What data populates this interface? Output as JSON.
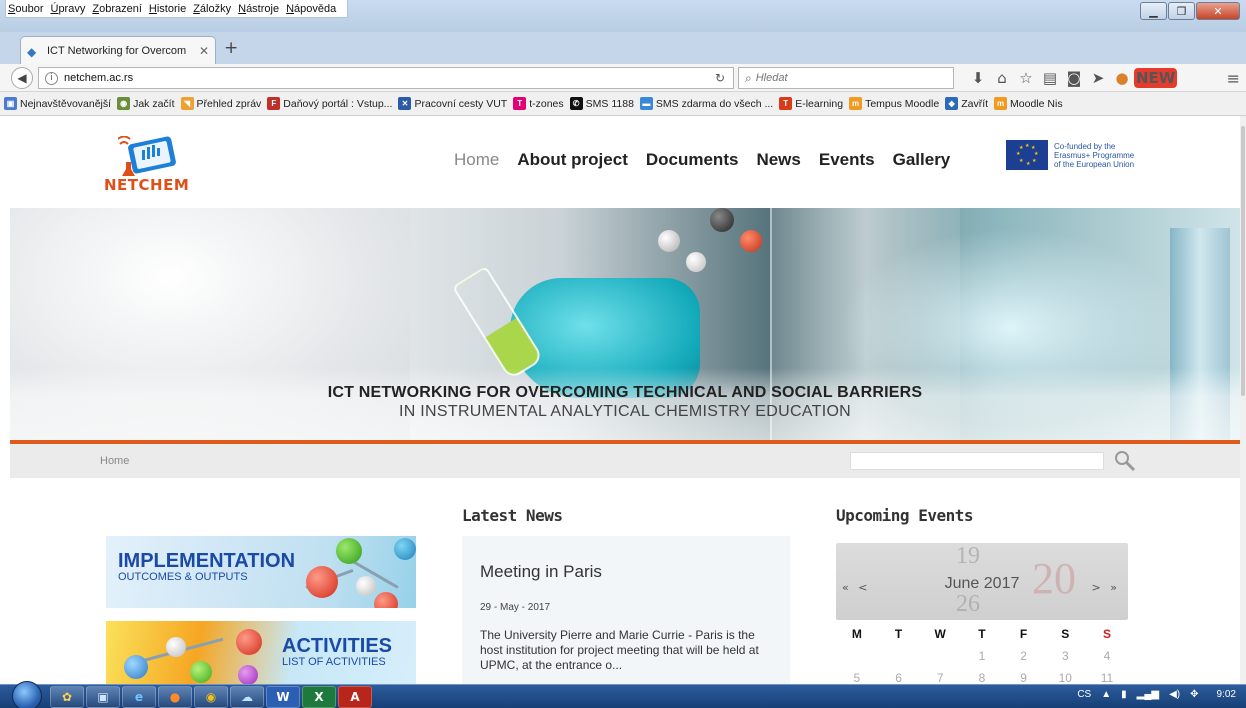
{
  "browser": {
    "menu": [
      "Soubor",
      "Úpravy",
      "Zobrazení",
      "Historie",
      "Záložky",
      "Nástroje",
      "Nápověda"
    ],
    "tab_title": "ICT Networking for Overcom",
    "url": "netchem.ac.rs",
    "search_placeholder": "Hledat",
    "new_badge": "NEW",
    "bookmarks": [
      {
        "label": "Nejnavštěvovanější",
        "color": "#4a7bd0"
      },
      {
        "label": "Jak začít",
        "color": "#6b8e3a"
      },
      {
        "label": "Přehled zpráv",
        "color": "#f0a030"
      },
      {
        "label": "Daňový portál : Vstup...",
        "color": "#c0302a"
      },
      {
        "label": "Pracovní cesty VUT",
        "color": "#2a5aa8"
      },
      {
        "label": "t-zones",
        "color": "#e20074"
      },
      {
        "label": "SMS 1188",
        "color": "#111111"
      },
      {
        "label": "SMS zdarma do všech ...",
        "color": "#3a88d8"
      },
      {
        "label": "E-learning",
        "color": "#d83a1a"
      },
      {
        "label": "Tempus Moodle",
        "color": "#f09a20"
      },
      {
        "label": "Zavřít",
        "color": "#2a6ab8"
      },
      {
        "label": "Moodle Nis",
        "color": "#f09a20"
      }
    ]
  },
  "site": {
    "logo_text": "NETCHEM",
    "nav": [
      "Home",
      "About project",
      "Documents",
      "News",
      "Events",
      "Gallery"
    ],
    "active_nav": "Home",
    "eu_text": [
      "Co-funded by the",
      "Erasmus+ Programme",
      "of the European Union"
    ],
    "hero_line1": "ICT NETWORKING FOR OVERCOMING TECHNICAL  AND SOCIAL BARRIERS",
    "hero_line2": "IN INSTRUMENTAL ANALYTICAL CHEMISTRY EDUCATION",
    "breadcrumb": "Home",
    "banner1_title": "IMPLEMENTATION",
    "banner1_sub": "OUTCOMES & OUTPUTS",
    "banner2_title": "ACTIVITIES",
    "banner2_sub": "LIST OF ACTIVITIES",
    "news_heading": "Latest News",
    "news_title": "Meeting in Paris",
    "news_date": "29 - May - 2017",
    "news_body": "The University Pierre and Marie Currie - Paris is the host institution for project meeting that will be held at UPMC, at the entrance o...",
    "events_heading": "Upcoming Events",
    "calendar": {
      "month": "June 2017",
      "prev": "« <",
      "next": "> »",
      "ghost_numbers": [
        "19",
        "20",
        "26"
      ],
      "weekdays": [
        "M",
        "T",
        "W",
        "T",
        "F",
        "S",
        "S"
      ],
      "row1": [
        "",
        "",
        "",
        "1",
        "2",
        "3",
        "4"
      ],
      "row2": [
        "5",
        "6",
        "7",
        "8",
        "9",
        "10",
        "11"
      ]
    }
  },
  "taskbar": {
    "lang": "CS",
    "clock": "9:02"
  }
}
